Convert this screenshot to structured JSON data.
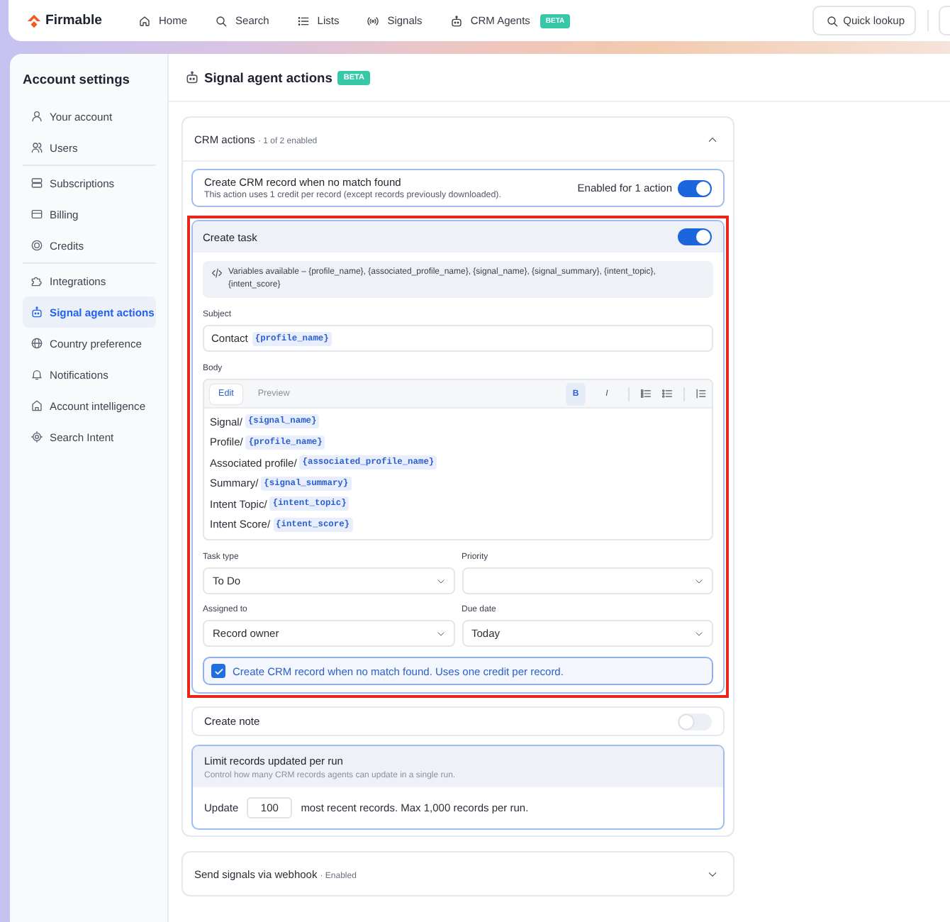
{
  "topbar": {
    "logo": "Firmable",
    "nav": [
      {
        "label": "Home"
      },
      {
        "label": "Search"
      },
      {
        "label": "Lists"
      },
      {
        "label": "Signals"
      },
      {
        "label": "CRM Agents",
        "badge": "BETA"
      }
    ],
    "quick_lookup": "Quick lookup"
  },
  "sidebar": {
    "title": "Account settings",
    "groups": [
      {
        "items": [
          {
            "label": "Your account",
            "selected": false
          },
          {
            "label": "Users",
            "selected": false
          }
        ]
      },
      {
        "items": [
          {
            "label": "Subscriptions",
            "selected": false
          },
          {
            "label": "Billing",
            "selected": false
          },
          {
            "label": "Credits",
            "selected": false
          }
        ]
      },
      {
        "items": [
          {
            "label": "Integrations",
            "selected": false
          },
          {
            "label": "Signal agent actions",
            "selected": true
          },
          {
            "label": "Country preference",
            "selected": false
          },
          {
            "label": "Notifications",
            "selected": false
          },
          {
            "label": "Account intelligence",
            "selected": false
          },
          {
            "label": "Search Intent",
            "selected": false
          }
        ]
      }
    ]
  },
  "page": {
    "title": "Signal agent actions",
    "badge": "BETA"
  },
  "sections": [
    {
      "title": "CRM actions",
      "status": "· 1 of 2 enabled",
      "expanded": true,
      "actions": [
        {
          "kind": "toggle",
          "title": "Create CRM record when no match found",
          "description": "This action uses 1 credit per record (except records previously downloaded).",
          "note": "Enabled for 1 action",
          "on": true,
          "highlighted": false
        },
        {
          "kind": "task",
          "title": "Create task",
          "on": true,
          "highlighted": true,
          "variables": "Variables available – {profile_name}, {associated_profile_name}, {signal_name}, {signal_summary}, {intent_topic}, {intent_score}",
          "subject": {
            "label": "Subject",
            "prefix": "Contact",
            "variable": "{profile_name}"
          },
          "body": {
            "label": "Body",
            "tabs": [
              {
                "label": "Edit",
                "selected": true
              },
              {
                "label": "Preview",
                "selected": false
              }
            ],
            "tool_groups": [
              {
                "tools": [
                  {
                    "kind": "text",
                    "label": "B",
                    "selected": true
                  },
                  {
                    "kind": "text",
                    "label": "I",
                    "selected": false
                  }
                ]
              },
              {
                "tools": [
                  {
                    "kind": "numbered",
                    "selected": false
                  },
                  {
                    "kind": "bulleted",
                    "selected": false
                  }
                ]
              },
              {
                "tools": [
                  {
                    "kind": "quote",
                    "selected": false
                  }
                ]
              }
            ],
            "lines": [
              {
                "label": "Signal/",
                "variable": "{signal_name}"
              },
              {
                "label": "Profile/",
                "variable": "{profile_name}"
              },
              {
                "label": "Associated profile/",
                "variable": "{associated_profile_name}"
              },
              {
                "label": "Summary/",
                "variable": "{signal_summary}"
              },
              {
                "label": "Intent Topic/",
                "variable": "{intent_topic}"
              },
              {
                "label": "Intent Score/",
                "variable": "{intent_score}"
              }
            ]
          },
          "fields": [
            {
              "label": "Task type",
              "value": "To Do"
            },
            {
              "label": "Priority"
            },
            {
              "label": "Assigned to",
              "value": "Record owner"
            },
            {
              "label": "Due date",
              "value": "Today"
            }
          ],
          "checkbox": {
            "label": "Create CRM record when no match found. Uses one credit per record.",
            "checked": true
          }
        },
        {
          "kind": "toggle",
          "title": "Create note",
          "on": false,
          "highlighted": false
        },
        {
          "kind": "limit",
          "title": "Limit records updated per run",
          "description": "Control how many CRM records agents can update in a single run.",
          "prefix": "Update",
          "value": "100",
          "suffix": "most recent records. Max 1,000 records per run.",
          "highlighted": false
        }
      ]
    },
    {
      "title": "Send signals via webhook",
      "status": "· Enabled",
      "expanded": false
    }
  ]
}
